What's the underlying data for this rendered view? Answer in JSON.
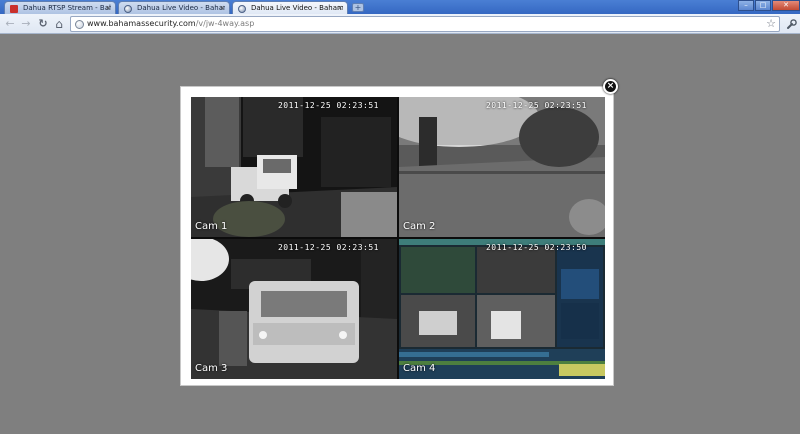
{
  "browser": {
    "tabs": [
      {
        "label": "Dahua RTSP Stream - Bahamas",
        "active": false
      },
      {
        "label": "Dahua Live Video - BahamasSe",
        "active": false
      },
      {
        "label": "Dahua Live Video - BahamasSe",
        "active": true
      }
    ],
    "new_tab": "+",
    "window_controls": {
      "minimize": "–",
      "maximize": "□",
      "close": "✕"
    },
    "nav": {
      "back": "←",
      "forward": "→",
      "reload": "↻",
      "home": "⌂"
    },
    "address": {
      "host": "www.bahamassecurity.com",
      "path": "/v/jw-4way.asp"
    },
    "star": "☆",
    "wrench": "🔧"
  },
  "lightbox": {
    "close": "×",
    "cameras": [
      {
        "label": "Cam 1",
        "timestamp": "2011-12-25 02:23:51"
      },
      {
        "label": "Cam 2",
        "timestamp": "2011-12-25 02:23:51"
      },
      {
        "label": "Cam 3",
        "timestamp": "2011-12-25 02:23:51"
      },
      {
        "label": "Cam 4",
        "timestamp": "2011-12-25 02:23:50"
      }
    ]
  },
  "colors": {
    "page_bg": "#7f7f7f",
    "tabstrip": "#3568c2",
    "lightbox_bg": "#ffffff"
  }
}
